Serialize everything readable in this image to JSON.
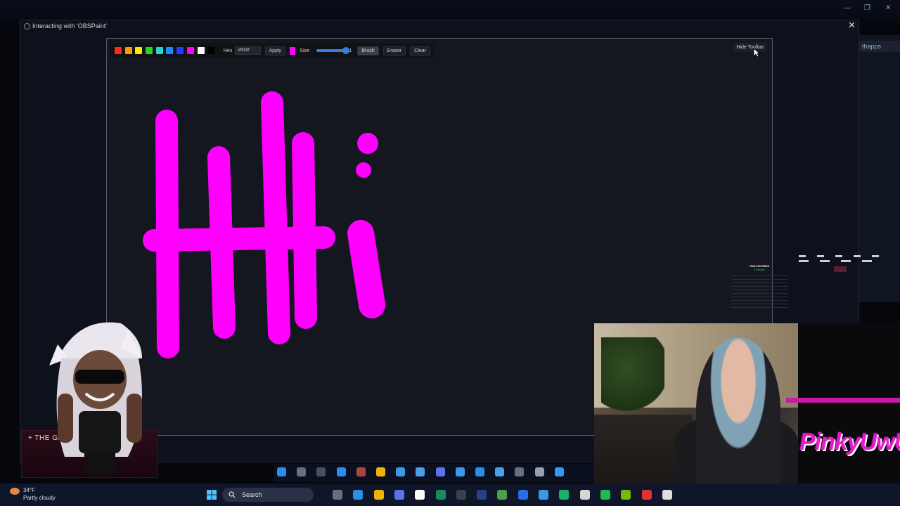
{
  "dialog": {
    "title": "Interacting with 'OBSPaint'",
    "close_label": "✕"
  },
  "background_app": {
    "tab_label": "thapps",
    "window_controls": [
      "—",
      "❐",
      "✕"
    ]
  },
  "toolbar": {
    "swatches": [
      "#ff2a1a",
      "#ff9a00",
      "#ffe600",
      "#2ad12a",
      "#2ad1d1",
      "#1a8cff",
      "#2a3cff",
      "#ff00ff",
      "#ffffff",
      "#000000"
    ],
    "hex_label": "Hex",
    "hex_value": "#ff00ff",
    "apply_label": "Apply",
    "current_color": "#ff00ff",
    "size_label": "Size",
    "size_value": "51",
    "size_fraction": 0.88,
    "brush_label": "Brush",
    "eraser_label": "Eraser",
    "clear_label": "Clear",
    "hide_toolbar_label": "Hide Toolbar"
  },
  "scores_widget": {
    "title": "HIGH SCORES",
    "subtitle": "Channel"
  },
  "banner": {
    "text": "+ THE GA          LEED +"
  },
  "taskbar": {
    "search_placeholder": "Search",
    "weather_temp": "34°F",
    "weather_desc": "Partly cloudy"
  },
  "logo": {
    "text": "PinkyUwU"
  },
  "brush_color": "#ff00ff"
}
